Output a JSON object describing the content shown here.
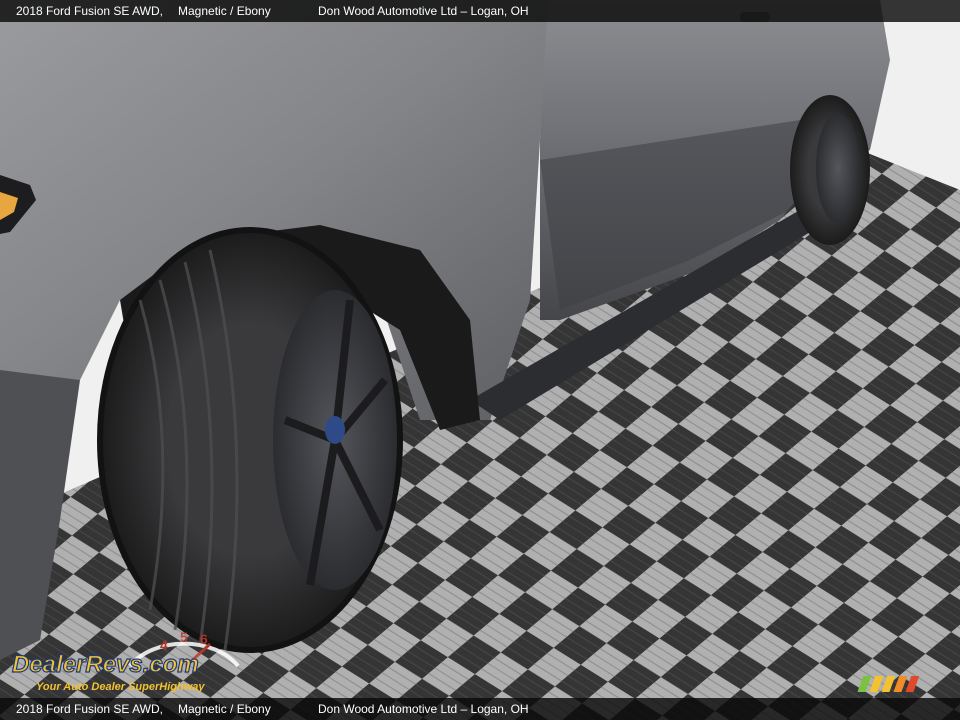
{
  "caption": {
    "title": "2018 Ford Fusion SE AWD,",
    "color": "Magnetic / Ebony",
    "dealer": "Don Wood Automotive Ltd – Logan, OH"
  },
  "watermark": {
    "brand": "DealerRevs.com",
    "tagline": "Your Auto Dealer SuperHighway",
    "icon": "speedometer-icon"
  },
  "photo": {
    "subject": "car-side-front-wheel",
    "colors": {
      "body_paint": "#7b7c80",
      "floor_light": "#bdbdbd",
      "floor_dark": "#3a3a3a",
      "background_wall": "#f0f0f0"
    }
  }
}
